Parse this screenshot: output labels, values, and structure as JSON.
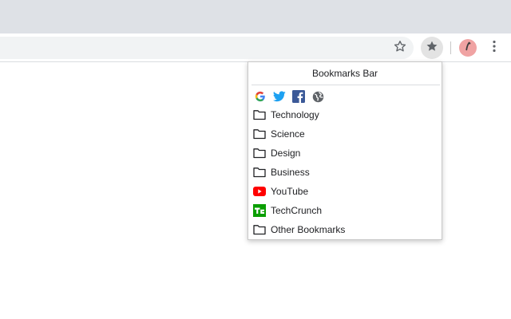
{
  "browser": {
    "toolbar": {
      "bookmark_page_icon": "star-outline-icon",
      "bookmarks_extension_icon": "star-filled-icon",
      "profile_icon": "avatar-icon",
      "menu_icon": "more-vert-icon"
    }
  },
  "popup": {
    "title": "Bookmarks Bar",
    "quick_links": [
      {
        "icon": "google-icon"
      },
      {
        "icon": "twitter-icon"
      },
      {
        "icon": "facebook-icon"
      },
      {
        "icon": "globe-icon"
      }
    ],
    "items": [
      {
        "label": "Technology",
        "icon": "folder-icon"
      },
      {
        "label": "Science",
        "icon": "folder-icon"
      },
      {
        "label": "Design",
        "icon": "folder-icon"
      },
      {
        "label": "Business",
        "icon": "folder-icon"
      },
      {
        "label": "YouTube",
        "icon": "youtube-icon"
      },
      {
        "label": "TechCrunch",
        "icon": "techcrunch-icon"
      },
      {
        "label": "Other Bookmarks",
        "icon": "folder-icon"
      }
    ]
  },
  "colors": {
    "tabstrip": "#dee1e6",
    "omnibox": "#f1f3f4",
    "youtube_red": "#ff0000",
    "techcrunch_green": "#0a9e01",
    "twitter_blue": "#1da1f2",
    "facebook_blue": "#3b5998"
  }
}
